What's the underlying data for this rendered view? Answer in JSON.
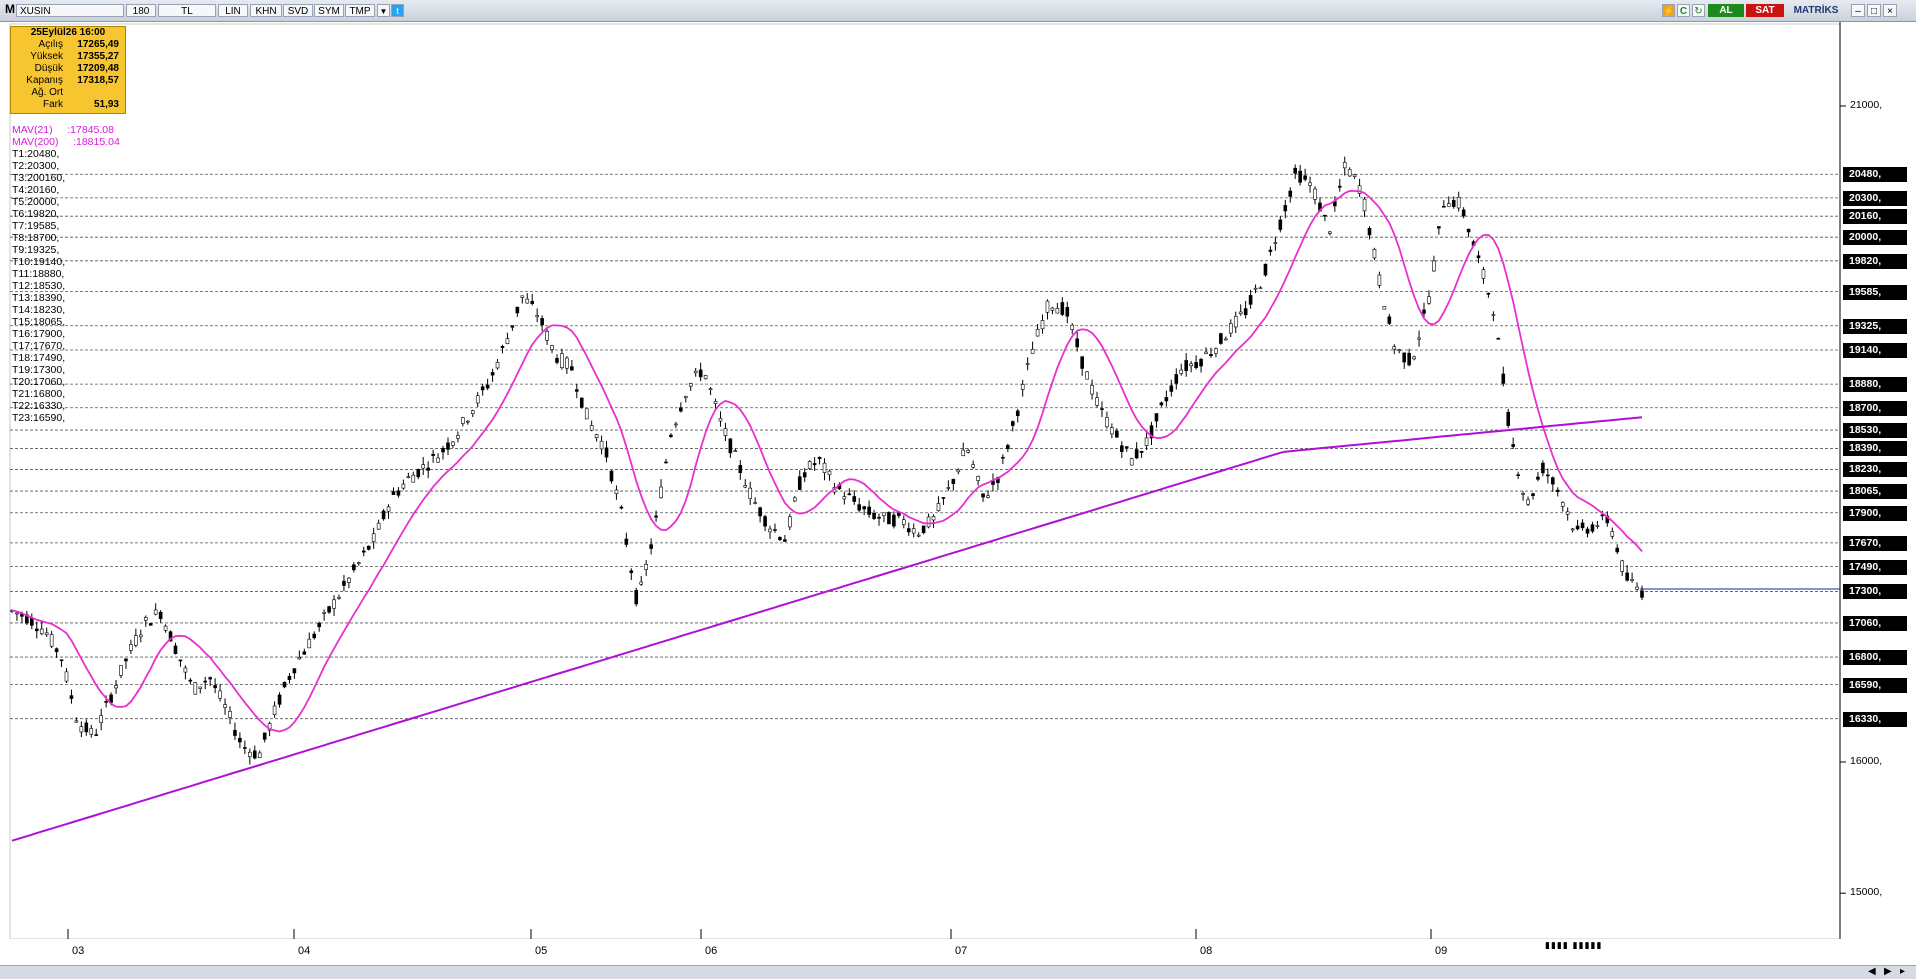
{
  "toolbar": {
    "menu_label": "M",
    "symbol": "XUSIN",
    "period": "180",
    "currency": "TL",
    "buttons": [
      "LIN",
      "KHN",
      "SVD",
      "SYM",
      "TMP"
    ],
    "right_c": "C",
    "buy_label": "AL",
    "sell_label": "SAT",
    "brand": "MATRİKS",
    "colors": {
      "buy": "#1c8a1c",
      "sell": "#cc1111",
      "twitter": "#2aa3ef"
    }
  },
  "ohlc": {
    "header": "25Eylül26 16:00",
    "rows": [
      {
        "label": "Açılış",
        "value": "17265,49"
      },
      {
        "label": "Yüksek",
        "value": "17355,27"
      },
      {
        "label": "Düşük",
        "value": "17209,48"
      },
      {
        "label": "Kapanış",
        "value": "17318,57"
      },
      {
        "label": "Ağ. Ort",
        "value": ""
      },
      {
        "label": "Fark",
        "value": "51,93"
      }
    ]
  },
  "legend": {
    "mav21": "MAV(21)     :17845.08",
    "mav200": "MAV(200)     :18815.04",
    "levels": [
      "T1:20480,",
      "T2:20300,",
      "T3:200160,",
      "T4:20160,",
      "T5:20000,",
      "T6:19820,",
      "T7:19585,",
      "T8:18700,",
      "T9:19325,",
      "T10:19140,",
      "T11:18880,",
      "T12:18530,",
      "T13:18390,",
      "T14:18230,",
      "T15:18065,",
      "T16:17900,",
      "T17:17670,",
      "T18:17490,",
      "T19:17300,",
      "T20:17060,",
      "T21:16800,",
      "T22:16330,",
      "T23:16590,"
    ]
  },
  "chart_data": {
    "type": "candlestick",
    "y_ticks": [
      15000,
      16000,
      21000
    ],
    "y_tick_labels": [
      "15000,",
      "16000,",
      "21000,"
    ],
    "x_labels": [
      "03",
      "04",
      "05",
      "06",
      "07",
      "08",
      "09"
    ],
    "last_price": 17318.57,
    "levels": [
      {
        "value": 20480,
        "label": "20480,"
      },
      {
        "value": 20300,
        "label": "20300,"
      },
      {
        "value": 20160,
        "label": "20160,"
      },
      {
        "value": 20000,
        "label": "20000,"
      },
      {
        "value": 19820,
        "label": "19820,"
      },
      {
        "value": 19585,
        "label": "19585,"
      },
      {
        "value": 19325,
        "label": "19325,"
      },
      {
        "value": 19140,
        "label": "19140,"
      },
      {
        "value": 18880,
        "label": "18880,"
      },
      {
        "value": 18700,
        "label": "18700,"
      },
      {
        "value": 18530,
        "label": "18530,"
      },
      {
        "value": 18390,
        "label": "18390,"
      },
      {
        "value": 18230,
        "label": "18230,"
      },
      {
        "value": 18065,
        "label": "18065,"
      },
      {
        "value": 17900,
        "label": "17900,"
      },
      {
        "value": 17670,
        "label": "17670,"
      },
      {
        "value": 17490,
        "label": "17490,"
      },
      {
        "value": 17300,
        "label": "17300,"
      },
      {
        "value": 17060,
        "label": "17060,"
      },
      {
        "value": 16800,
        "label": "16800,"
      },
      {
        "value": 16590,
        "label": "16590,"
      },
      {
        "value": 16330,
        "label": "16330,"
      }
    ],
    "price_path": [
      17150,
      17100,
      17000,
      16800,
      16300,
      16200,
      16500,
      16800,
      17050,
      17150,
      16850,
      16550,
      16650,
      16400,
      16120,
      16050,
      16400,
      16700,
      16900,
      17100,
      17300,
      17500,
      17700,
      18000,
      18150,
      18250,
      18350,
      18500,
      18700,
      18900,
      19200,
      19550,
      19400,
      19100,
      19000,
      18600,
      18400,
      17900,
      17200,
      17750,
      18500,
      18850,
      19000,
      18600,
      18300,
      18000,
      17800,
      17700,
      18200,
      18300,
      18100,
      18000,
      17900,
      17850,
      17850,
      17750,
      17850,
      18100,
      18400,
      18000,
      18200,
      18650,
      19150,
      19500,
      19450,
      19050,
      18700,
      18500,
      18300,
      18450,
      18750,
      19000,
      19050,
      19150,
      19300,
      19450,
      19700,
      20100,
      20500,
      20380,
      20050,
      20550,
      20350,
      19700,
      19150,
      19050,
      19500,
      20300,
      20250,
      19850,
      19450,
      18500,
      17950,
      18250,
      18050,
      17750,
      17800,
      17850,
      17400,
      17300
    ],
    "ma_colors": {
      "mav21": "#e82fd0",
      "mav200": "#b10fd6"
    }
  }
}
